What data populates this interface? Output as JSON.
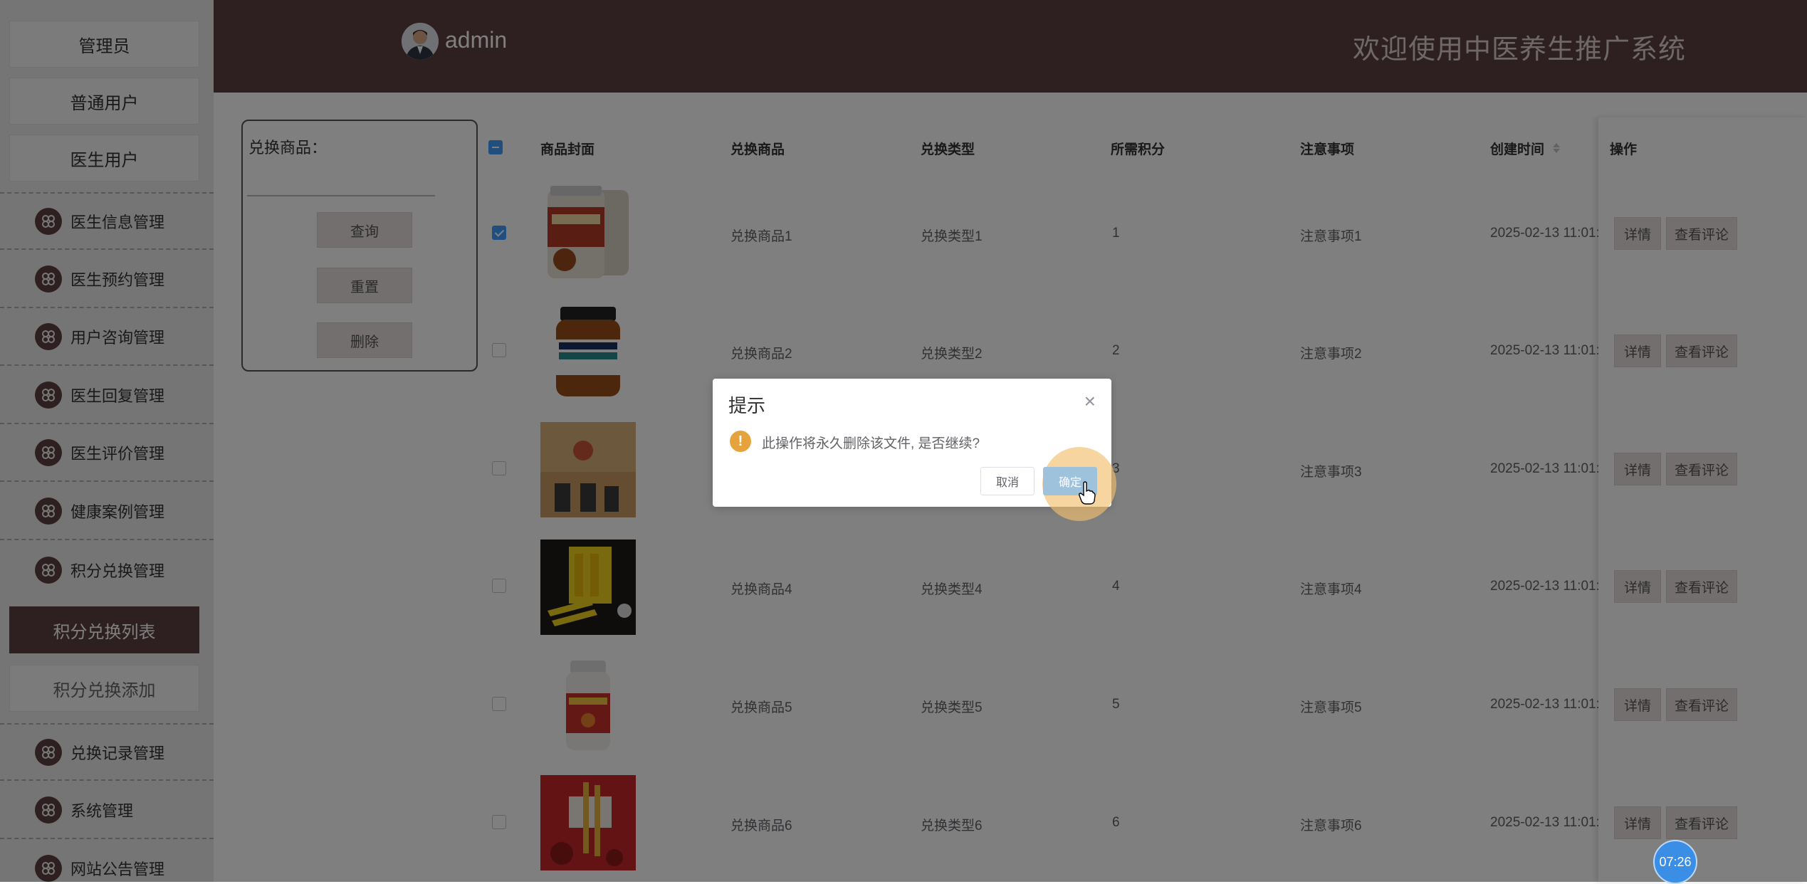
{
  "sidebar": {
    "top_buttons": [
      "管理员",
      "普通用户",
      "医生用户"
    ],
    "menu_items": [
      "医生信息管理",
      "医生预约管理",
      "用户咨询管理",
      "医生回复管理",
      "医生评价管理",
      "健康案例管理",
      "积分兑换管理"
    ],
    "sub_items": {
      "active": "积分兑换列表",
      "add": "积分兑换添加"
    },
    "menu_items_after": [
      "兑换记录管理",
      "系统管理",
      "网站公告管理"
    ]
  },
  "header": {
    "username": "admin",
    "site_title": "欢迎使用中医养生推广系统"
  },
  "search": {
    "label": "兑换商品：",
    "query_btn": "查询",
    "reset_btn": "重置",
    "delete_btn": "删除"
  },
  "table": {
    "columns": [
      "商品封面",
      "兑换商品",
      "兑换类型",
      "所需积分",
      "注意事项",
      "创建时间",
      "操作"
    ],
    "sort_icon": "sort-caret-icon",
    "detail_btn": "详情",
    "comment_btn": "查看评论",
    "rows": [
      {
        "product": "兑换商品1",
        "type": "兑换类型1",
        "points": "1",
        "note": "注意事项1",
        "created": "2025-02-13 11:01:",
        "checked": true
      },
      {
        "product": "兑换商品2",
        "type": "兑换类型2",
        "points": "2",
        "note": "注意事项2",
        "created": "2025-02-13 11:01:",
        "checked": false
      },
      {
        "product": "",
        "type": "",
        "points": "3",
        "note": "注意事项3",
        "created": "2025-02-13 11:01:",
        "checked": false
      },
      {
        "product": "兑换商品4",
        "type": "兑换类型4",
        "points": "4",
        "note": "注意事项4",
        "created": "2025-02-13 11:01:",
        "checked": false
      },
      {
        "product": "兑换商品5",
        "type": "兑换类型5",
        "points": "5",
        "note": "注意事项5",
        "created": "2025-02-13 11:01:",
        "checked": false
      },
      {
        "product": "兑换商品6",
        "type": "兑换类型6",
        "points": "6",
        "note": "注意事项6",
        "created": "2025-02-13 11:01:",
        "checked": false
      }
    ]
  },
  "dialog": {
    "title": "提示",
    "message": "此操作将永久删除该文件, 是否继续?",
    "cancel": "取消",
    "confirm": "确定",
    "warning_glyph": "!",
    "close_glyph": "×"
  },
  "timer": "07:26",
  "colors": {
    "brand": "#5c4141",
    "primary": "#409eff",
    "warning": "#e6a23c"
  }
}
